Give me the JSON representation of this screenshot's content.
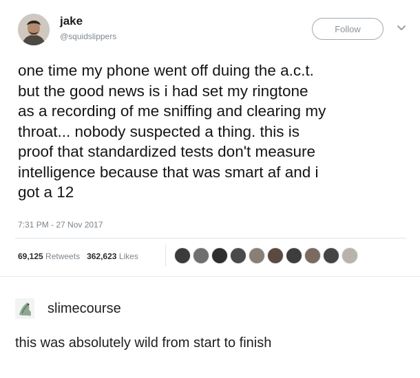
{
  "tweet": {
    "author": {
      "display_name": "jake",
      "handle": "@squidslippers",
      "avatar_icon": "user-avatar-photo"
    },
    "follow_label": "Follow",
    "menu_icon": "chevron-down-icon",
    "lines": [
      "one time my phone went off duing the a.c.t.",
      "but the good news is i had set my ringtone",
      "as a recording of me sniffing and clearing my",
      "throat... nobody suspected a thing. this is",
      "proof that standardized tests don't measure",
      "intelligence because that was smart af and i",
      "got a 12"
    ],
    "timestamp": "7:31 PM - 27 Nov 2017",
    "stats": {
      "retweets_count": "69,125",
      "retweets_label": "Retweets",
      "likes_count": "362,623",
      "likes_label": "Likes"
    },
    "liker_avatar_colors": [
      "#3b3b3b",
      "#6f6f6f",
      "#2e2e2e",
      "#4a4a4a",
      "#8a7f74",
      "#5a4a3f",
      "#3d3d3d",
      "#7a6a60",
      "#444444",
      "#b9b3ad"
    ]
  },
  "reply": {
    "username": "slimecourse",
    "text": "this was absolutely wild from start to finish",
    "avatar_icon": "reply-avatar-image"
  }
}
